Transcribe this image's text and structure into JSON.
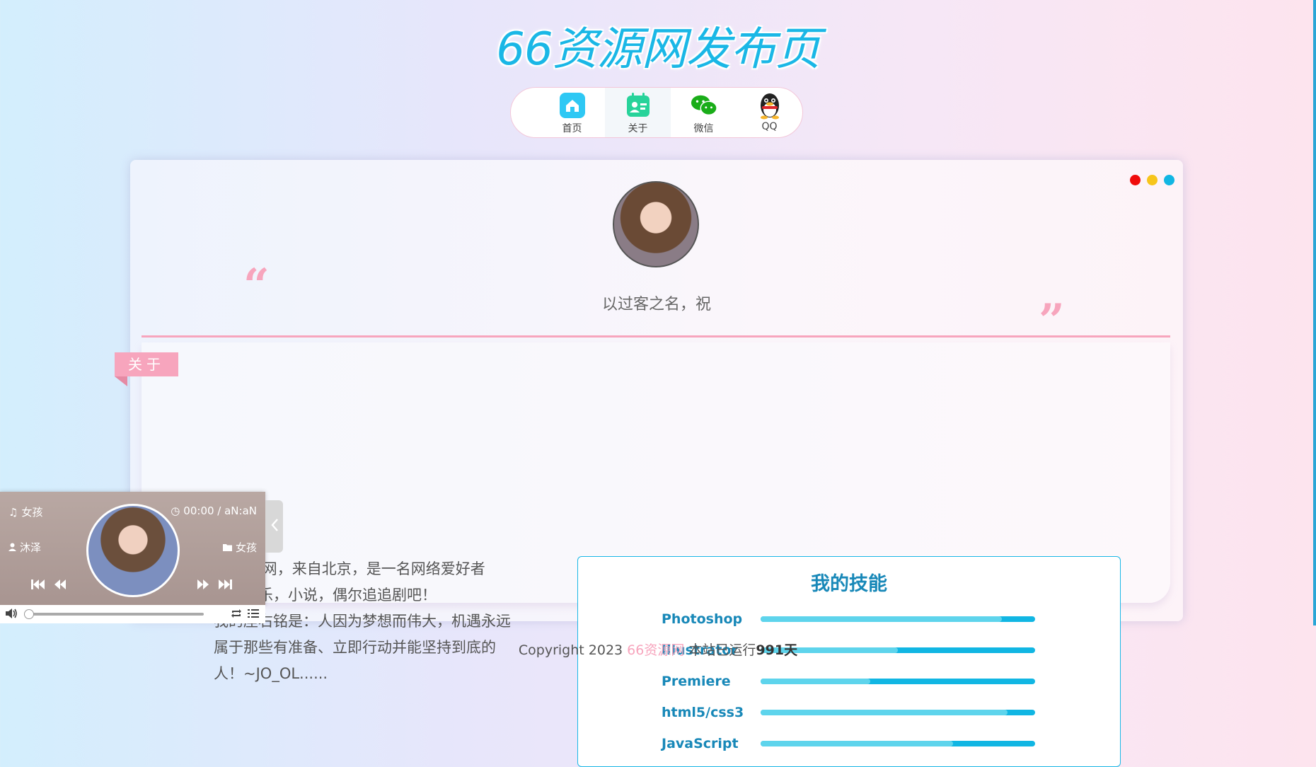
{
  "site": {
    "title": "66资源网发布页"
  },
  "nav": [
    {
      "label": "首页",
      "icon": "home-icon",
      "color": "#2ec8f4"
    },
    {
      "label": "关于",
      "icon": "profile-card-icon",
      "color": "#27d39a"
    },
    {
      "label": "微信",
      "icon": "wechat-icon",
      "color": "#1aad19"
    },
    {
      "label": "QQ",
      "icon": "qq-penguin-icon",
      "color": "#222222"
    }
  ],
  "card": {
    "window_dots": [
      "#f00b0b",
      "#f7c51b",
      "#11b6e3"
    ],
    "motto": "以过客之名，祝",
    "about_tag": "关于",
    "about_lines": [
      "66资源网，来自北京，是一名网络爱好者",
      "喜欢音乐，小说，偶尔追追剧吧！",
      "我的座右铭是：人因为梦想而伟大，机遇永远",
      "属于那些有准备、立即行动并能坚持到底的",
      "人！~JO_OL......"
    ],
    "skills_title": "我的技能",
    "skills": [
      {
        "name": "Photoshop",
        "level": 0.88
      },
      {
        "name": "Illustrator",
        "level": 0.5
      },
      {
        "name": "Premiere",
        "level": 0.4
      },
      {
        "name": "html5/css3",
        "level": 0.9
      },
      {
        "name": "JavaScript",
        "level": 0.7
      }
    ]
  },
  "player": {
    "song": "女孩",
    "time": "00:00 / aN:aN",
    "artist": "沐泽",
    "album": "女孩",
    "progress": 0.0,
    "accent": "#f7a5bd"
  },
  "footer": {
    "prefix": "Copyright 2023",
    "brand": "66资源网",
    "running": "本站已运行",
    "days": "991天"
  }
}
